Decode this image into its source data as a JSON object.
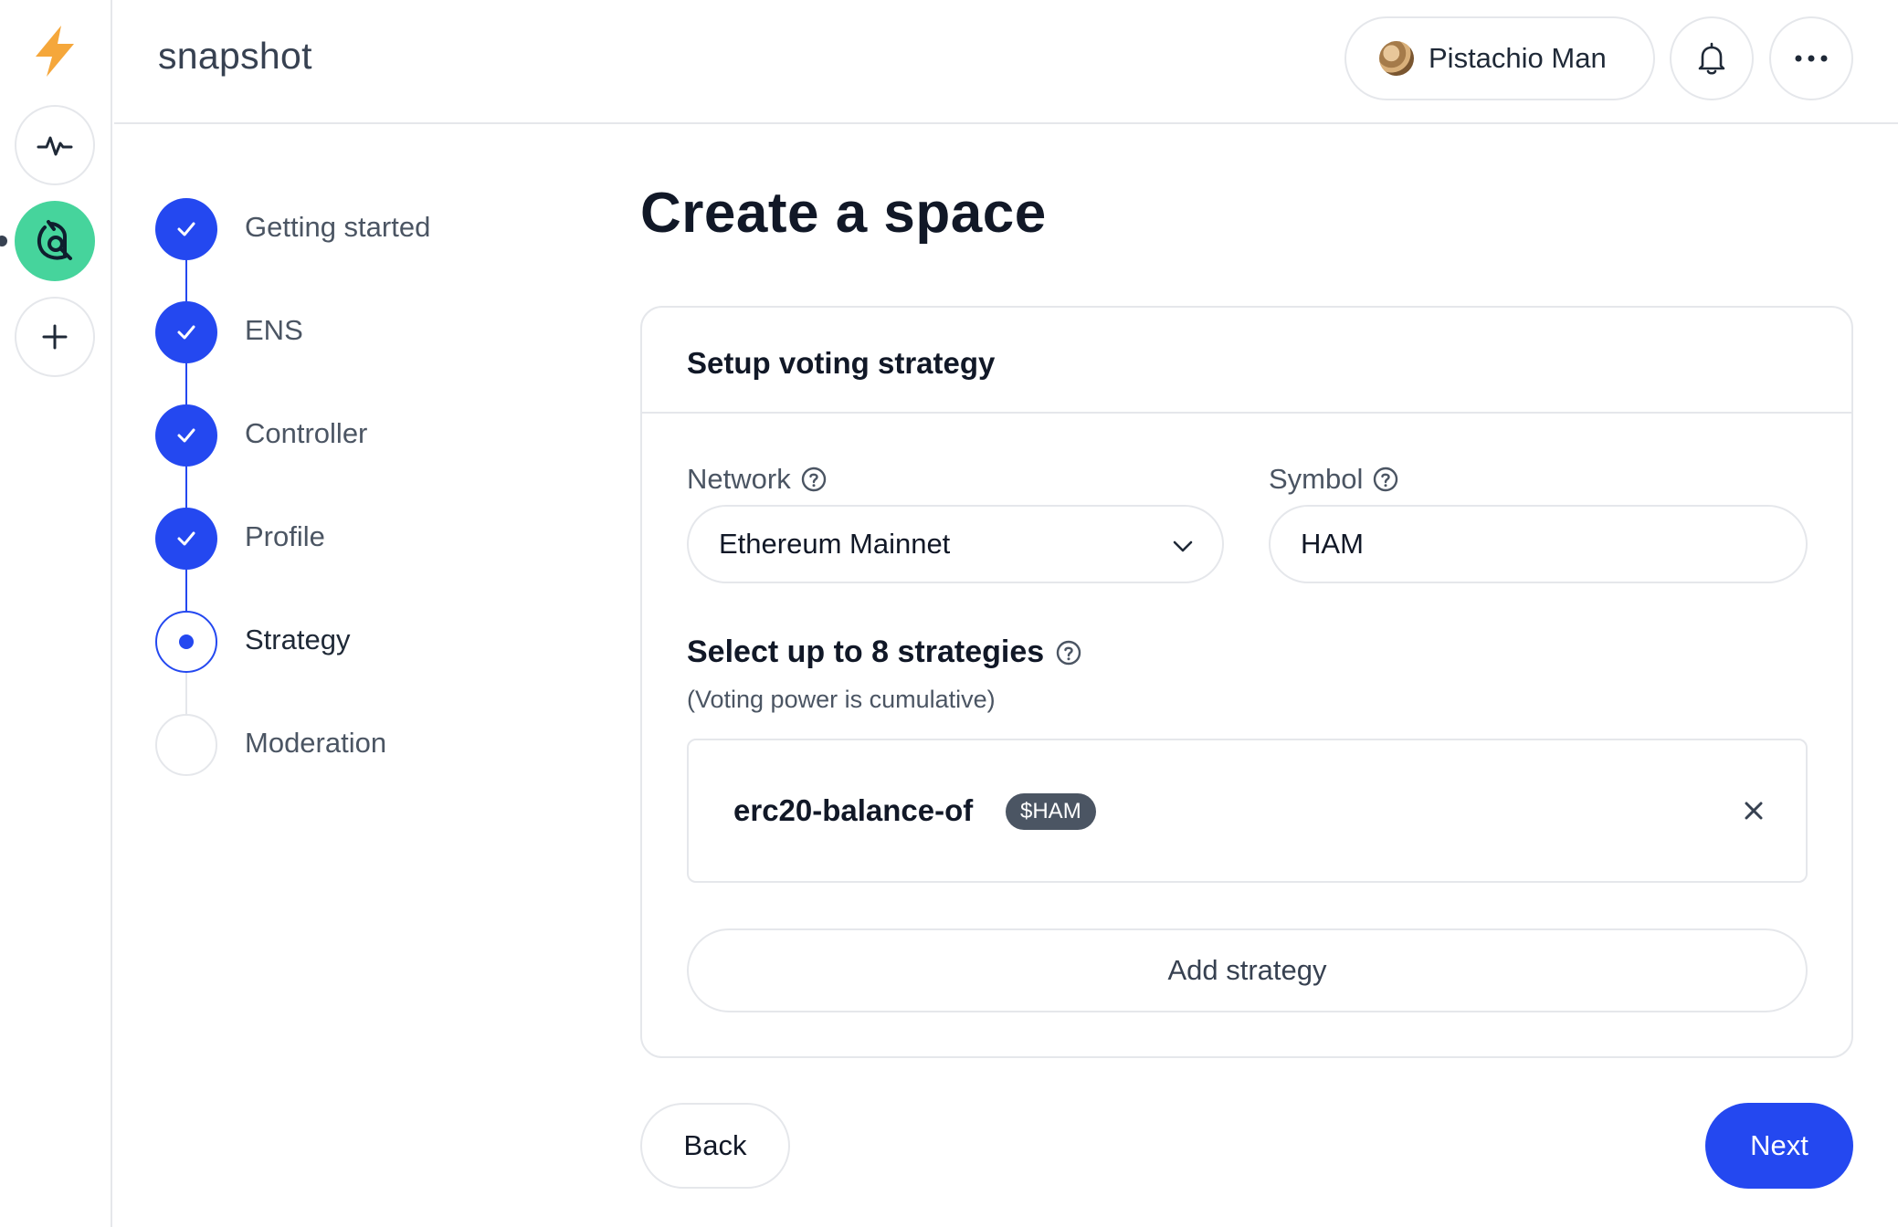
{
  "app": {
    "brand": "snapshot"
  },
  "rail": {
    "logo_icon": "bolt-icon",
    "activity_icon": "activity-icon",
    "add_icon": "plus-icon"
  },
  "header": {
    "user_name": "Pistachio Man",
    "bell_icon": "bell-icon",
    "more_icon": "more-icon"
  },
  "stepper": {
    "steps": [
      {
        "label": "Getting started",
        "status": "done"
      },
      {
        "label": "ENS",
        "status": "done"
      },
      {
        "label": "Controller",
        "status": "done"
      },
      {
        "label": "Profile",
        "status": "done"
      },
      {
        "label": "Strategy",
        "status": "current"
      },
      {
        "label": "Moderation",
        "status": "todo"
      }
    ]
  },
  "main": {
    "title": "Create a space",
    "card_title": "Setup voting strategy",
    "network": {
      "label": "Network",
      "value": "Ethereum Mainnet"
    },
    "symbol": {
      "label": "Symbol",
      "value": "HAM"
    },
    "strategies_title": "Select up to 8 strategies",
    "strategies_subtitle": "(Voting power is cumulative)",
    "strategies": [
      {
        "name": "erc20-balance-of",
        "badge": "$HAM"
      }
    ],
    "add_strategy_label": "Add strategy",
    "back_label": "Back",
    "next_label": "Next"
  },
  "colors": {
    "accent": "#2448f0",
    "space_bg": "#46d49c",
    "logo": "#f5a73b"
  }
}
